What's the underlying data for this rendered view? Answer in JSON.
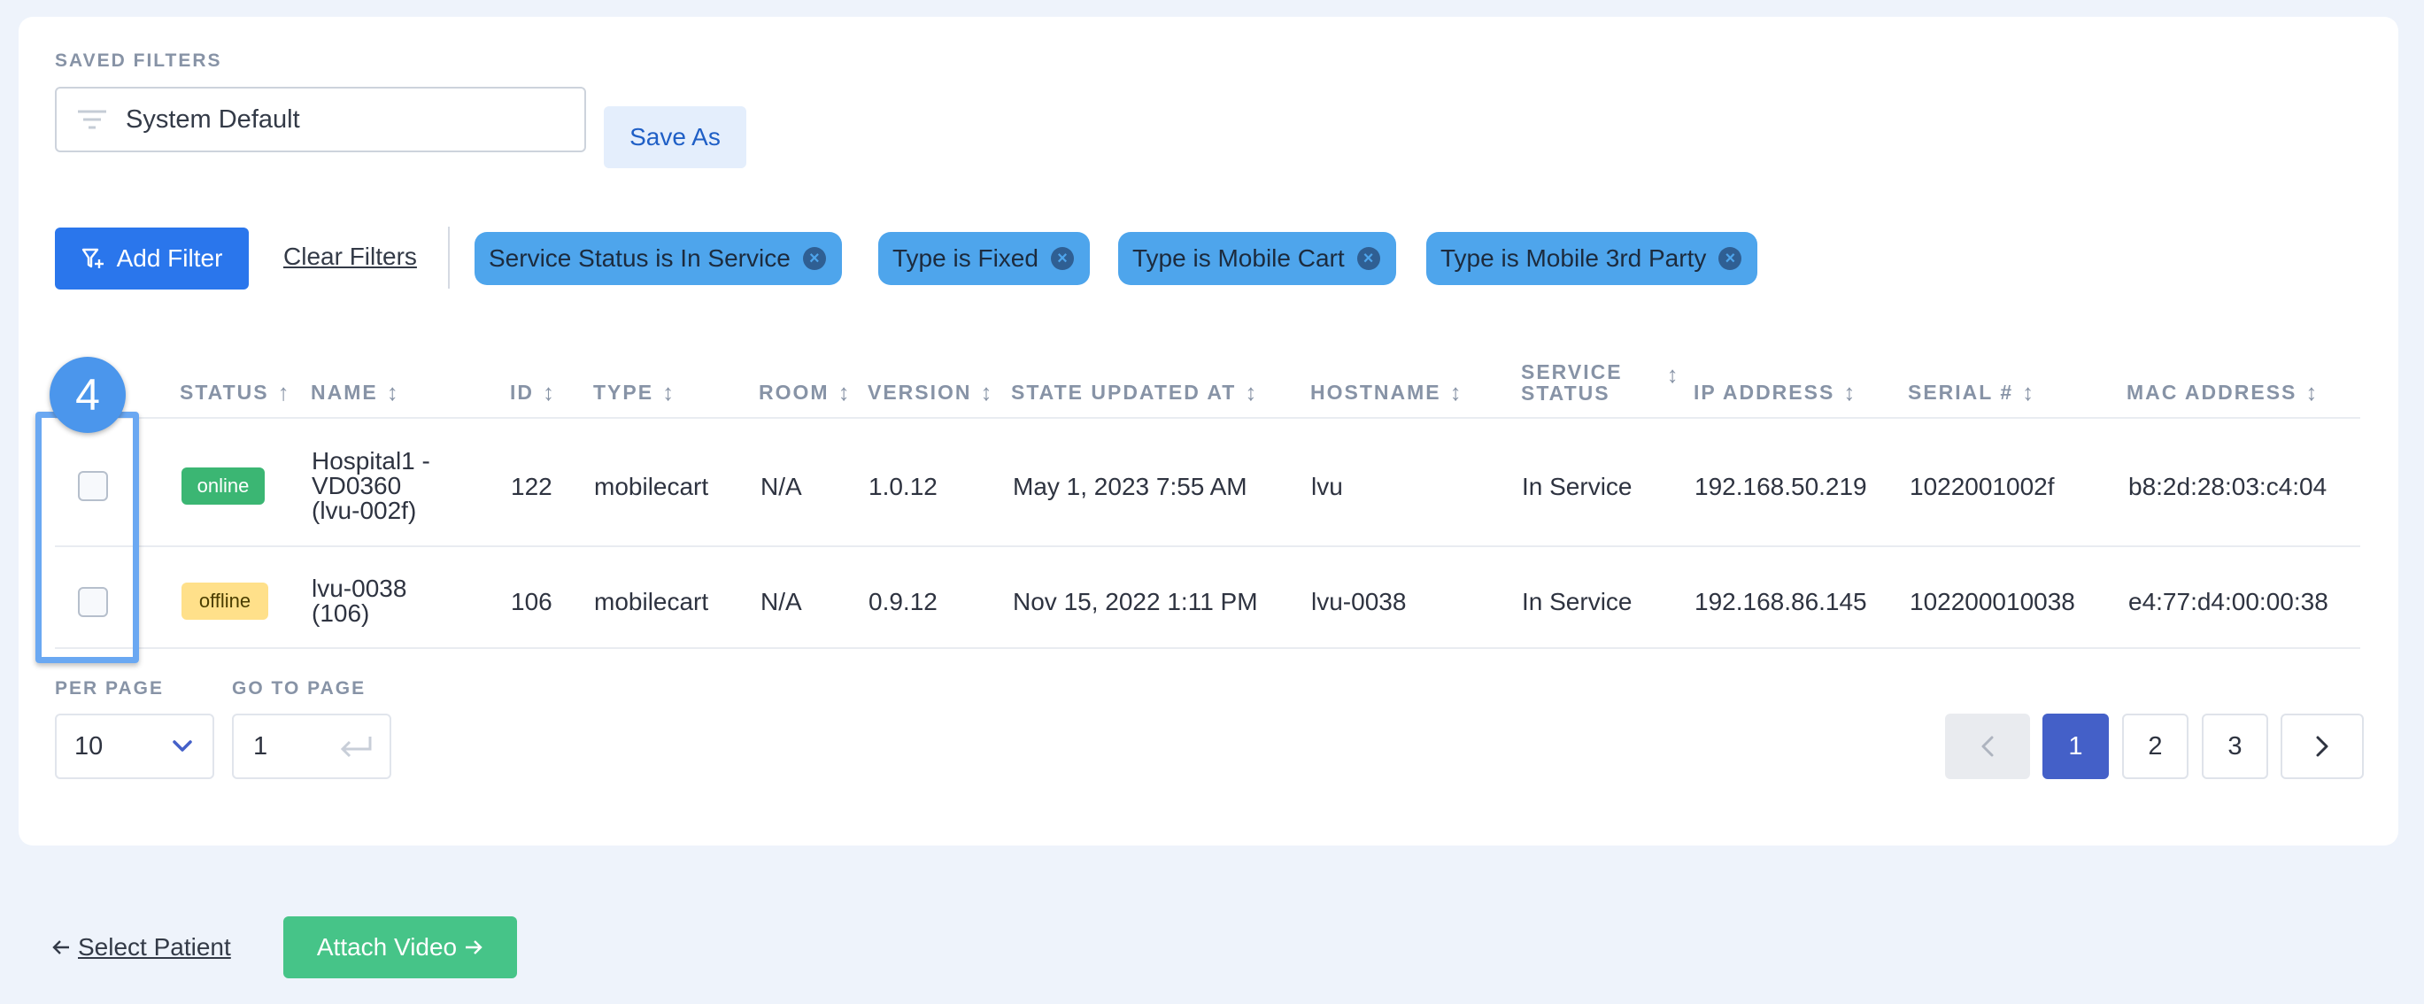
{
  "saved_filters": {
    "label": "SAVED FILTERS",
    "value": "System Default",
    "save_as_label": "Save As"
  },
  "filter_bar": {
    "add_filter_label": "Add Filter",
    "clear_filters_label": "Clear Filters",
    "chips": [
      {
        "label": "Service Status is In Service"
      },
      {
        "label": "Type is Fixed"
      },
      {
        "label": "Type is Mobile Cart"
      },
      {
        "label": "Type is Mobile 3rd Party"
      }
    ]
  },
  "table": {
    "columns": {
      "status": "STATUS",
      "name": "NAME",
      "id": "ID",
      "type": "TYPE",
      "room": "ROOM",
      "version": "VERSION",
      "state_updated_at": "STATE UPDATED AT",
      "hostname": "HOSTNAME",
      "service_status_1": "SERVICE",
      "service_status_2": "STATUS",
      "ip_address": "IP ADDRESS",
      "serial": "SERIAL #",
      "mac_address": "MAC ADDRESS"
    },
    "rows": [
      {
        "status": "online",
        "name_1": "Hospital1 -",
        "name_2": "VD0360",
        "name_3": "(lvu-002f)",
        "id": "122",
        "type": "mobilecart",
        "room": "N/A",
        "version": "1.0.12",
        "state_updated_at": "May 1, 2023 7:55 AM",
        "hostname": "lvu",
        "service_status": "In Service",
        "ip_address": "192.168.50.219",
        "serial": "1022001002f",
        "mac_address": "b8:2d:28:03:c4:04"
      },
      {
        "status": "offline",
        "name_1": "lvu-0038",
        "name_2": "(106)",
        "id": "106",
        "type": "mobilecart",
        "room": "N/A",
        "version": "0.9.12",
        "state_updated_at": "Nov 15, 2022 1:11 PM",
        "hostname": "lvu-0038",
        "service_status": "In Service",
        "ip_address": "192.168.86.145",
        "serial": "102200010038",
        "mac_address": "e4:77:d4:00:00:38"
      }
    ]
  },
  "highlight": {
    "number": "4"
  },
  "pagination": {
    "per_page_label": "PER PAGE",
    "per_page_value": "10",
    "go_to_page_label": "GO TO PAGE",
    "go_to_page_value": "1",
    "pages": [
      "1",
      "2",
      "3"
    ],
    "current_page": "1"
  },
  "footer": {
    "select_patient_label": "Select Patient",
    "attach_video_label": "Attach Video"
  },
  "colors": {
    "primary": "#2a76ec",
    "chip": "#4ea5ec",
    "online": "#3bb673",
    "offline": "#ffe08a",
    "active_page": "#4460c8",
    "attach": "#46c488"
  }
}
